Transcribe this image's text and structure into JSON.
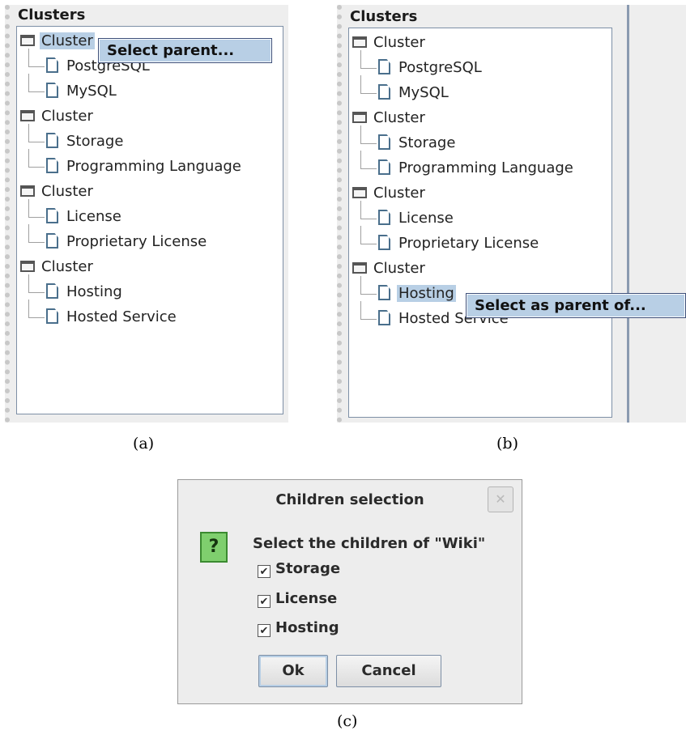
{
  "panel_a": {
    "title": "Clusters",
    "tree": [
      {
        "kind": "cluster",
        "label": "Cluster"
      },
      {
        "kind": "leaf",
        "label": "PostgreSQL"
      },
      {
        "kind": "leaf",
        "label": "MySQL"
      },
      {
        "kind": "cluster",
        "label": "Cluster"
      },
      {
        "kind": "leaf",
        "label": "Storage"
      },
      {
        "kind": "leaf",
        "label": "Programming Language"
      },
      {
        "kind": "cluster",
        "label": "Cluster"
      },
      {
        "kind": "leaf",
        "label": "License"
      },
      {
        "kind": "leaf",
        "label": "Proprietary License"
      },
      {
        "kind": "cluster",
        "label": "Cluster"
      },
      {
        "kind": "leaf",
        "label": "Hosting"
      },
      {
        "kind": "leaf",
        "label": "Hosted Service"
      }
    ],
    "selected_index": 0,
    "popup": "Select parent...",
    "caption": "(a)"
  },
  "panel_b": {
    "title": "Clusters",
    "tree": [
      {
        "kind": "cluster",
        "label": "Cluster"
      },
      {
        "kind": "leaf",
        "label": "PostgreSQL"
      },
      {
        "kind": "leaf",
        "label": "MySQL"
      },
      {
        "kind": "cluster",
        "label": "Cluster"
      },
      {
        "kind": "leaf",
        "label": "Storage"
      },
      {
        "kind": "leaf",
        "label": "Programming Language"
      },
      {
        "kind": "cluster",
        "label": "Cluster"
      },
      {
        "kind": "leaf",
        "label": "License"
      },
      {
        "kind": "leaf",
        "label": "Proprietary License"
      },
      {
        "kind": "cluster",
        "label": "Cluster"
      },
      {
        "kind": "leaf",
        "label": "Hosting"
      },
      {
        "kind": "leaf",
        "label": "Hosted Service"
      }
    ],
    "selected_index": 10,
    "popup": "Select as parent of...",
    "caption": "(b)"
  },
  "dialog": {
    "title": "Children selection",
    "close_icon": "close-icon",
    "question_icon": "?",
    "message": "Select the children of \"Wiki\"",
    "checkboxes": [
      {
        "label": "Storage",
        "checked": true
      },
      {
        "label": "License",
        "checked": true
      },
      {
        "label": "Hosting",
        "checked": true
      }
    ],
    "ok_label": "Ok",
    "cancel_label": "Cancel",
    "caption": "(c)"
  },
  "colors": {
    "selection": "#b8cfe5",
    "question_icon": "#7fcf6e",
    "tree_border": "#7d8fa6"
  }
}
